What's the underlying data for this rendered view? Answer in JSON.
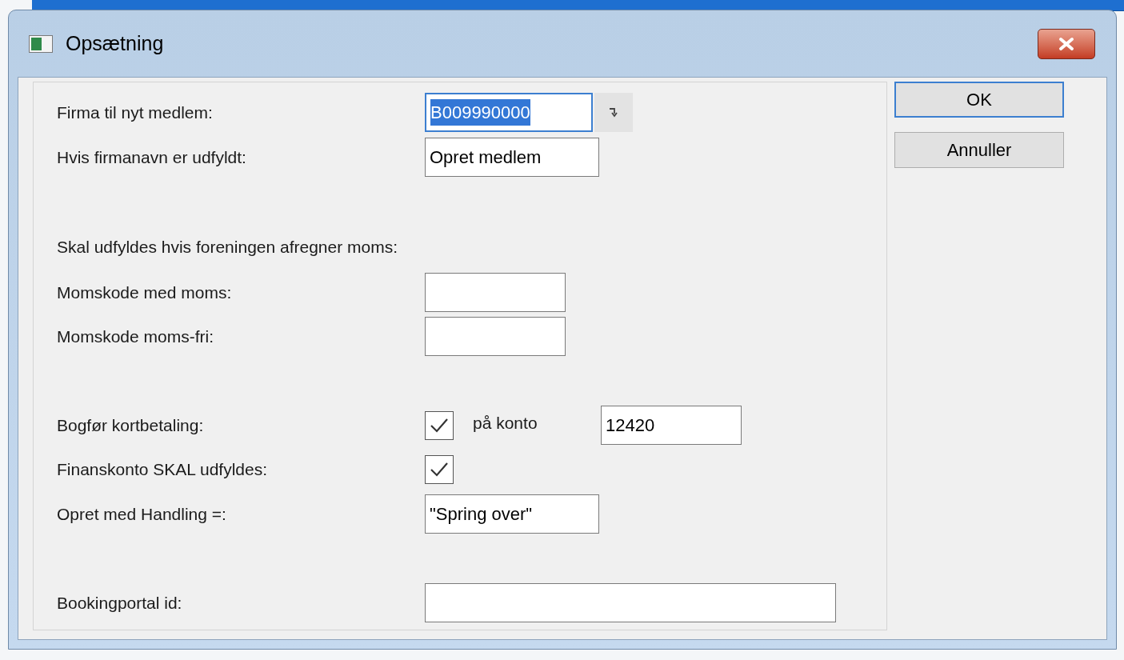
{
  "window": {
    "title": "Opsætning"
  },
  "rows": [
    {
      "kind": "text",
      "label": "Firma til nyt medlem:",
      "value": "B009990000",
      "focused": true,
      "lookup": true
    },
    {
      "kind": "text",
      "label": "Hvis firmanavn er udfyldt:",
      "value": "Opret medlem",
      "focused": false
    },
    {
      "kind": "heading",
      "label": "Skal udfyldes hvis foreningen afregner moms:"
    },
    {
      "kind": "text",
      "label": "Momskode med moms:",
      "focused": false
    },
    {
      "kind": "text",
      "label": "Momskode moms-fri:",
      "focused": false
    },
    {
      "kind": "checkbox_account",
      "label": "Bogfør kortbetaling:",
      "checked": true,
      "suffix": "på konto",
      "value": "12420",
      "focused": false
    },
    {
      "kind": "checkbox",
      "label": "Finanskonto SKAL udfyldes:",
      "checked": true
    },
    {
      "kind": "text",
      "label": "Opret med Handling =:",
      "value": "\"Spring over\"",
      "focused": false
    },
    {
      "kind": "text",
      "label": "Bookingportal id:",
      "focused": false
    }
  ],
  "buttons": [
    {
      "label": "OK",
      "default": true
    },
    {
      "label": "Annuller",
      "default": false
    }
  ]
}
